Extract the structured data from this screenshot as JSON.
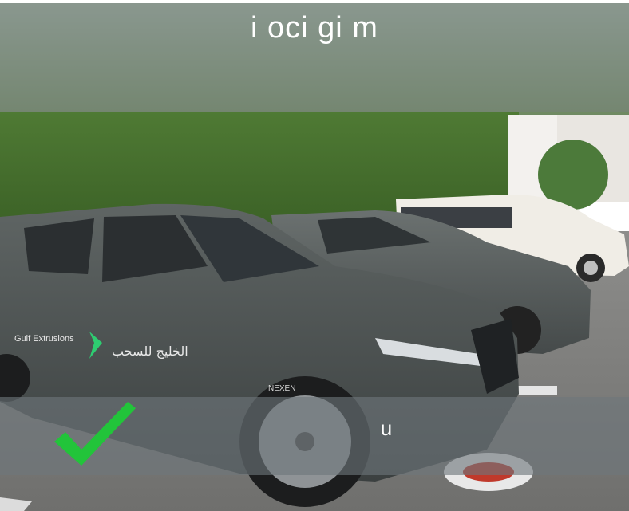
{
  "overlay": {
    "top_title": "i oci gi m",
    "bottom_label": "u"
  },
  "photo": {
    "door_text_left": "Gulf Extrusions",
    "door_text_right": "الخليج للسحب",
    "tire_text": "NEXEN"
  },
  "icons": {
    "check": "checkmark-icon"
  },
  "colors": {
    "check_green": "#22c43a",
    "banner_overlay": "#78847c",
    "bottom_overlay": "#6e767a"
  }
}
